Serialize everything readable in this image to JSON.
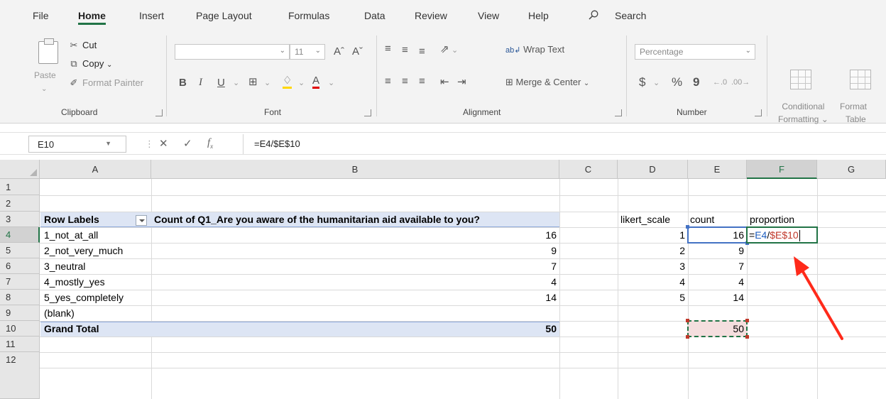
{
  "ribbon_tabs": [
    "File",
    "Home",
    "Insert",
    "Page Layout",
    "Formulas",
    "Data",
    "Review",
    "View",
    "Help"
  ],
  "active_tab": "Home",
  "search_label": "Search",
  "clipboard": {
    "paste": "Paste",
    "cut": "Cut",
    "copy": "Copy",
    "format_painter": "Format Painter",
    "group": "Clipboard"
  },
  "font": {
    "size": "11",
    "bold": "B",
    "italic": "I",
    "underline": "U",
    "group": "Font"
  },
  "alignment": {
    "wrap_text": "Wrap Text",
    "merge_center": "Merge & Center",
    "group": "Alignment"
  },
  "number": {
    "format": "Percentage",
    "currency": "$",
    "percent": "%",
    "comma": "9",
    "group": "Number"
  },
  "styles": {
    "conditional_1": "Conditional",
    "conditional_2": "Formatting",
    "format_table_1": "Format",
    "format_table_2": "Table"
  },
  "formula_bar": {
    "name_box": "E10",
    "formula": "=E4/$E$10"
  },
  "columns": [
    "A",
    "B",
    "C",
    "D",
    "E",
    "F",
    "G"
  ],
  "selected_column": "F",
  "rows": [
    "1",
    "2",
    "3",
    "4",
    "5",
    "6",
    "7",
    "8",
    "9",
    "10",
    "11",
    "12"
  ],
  "selected_row": "4",
  "pivot": {
    "header_labels": "Row Labels",
    "header_values": "Count of Q1_Are you aware of the humanitarian aid available to you?",
    "rows": [
      {
        "label": "1_not_at_all",
        "value": "16"
      },
      {
        "label": "2_not_very_much",
        "value": "9"
      },
      {
        "label": "3_neutral",
        "value": "7"
      },
      {
        "label": "4_mostly_yes",
        "value": "4"
      },
      {
        "label": "5_yes_completely",
        "value": "14"
      },
      {
        "label": "(blank)",
        "value": ""
      }
    ],
    "grand_total_label": "Grand Total",
    "grand_total_value": "50"
  },
  "side_table": {
    "headers": [
      "likert_scale",
      "count",
      "proportion"
    ],
    "rows": [
      {
        "scale": "1",
        "count": "16"
      },
      {
        "scale": "2",
        "count": "9"
      },
      {
        "scale": "3",
        "count": "7"
      },
      {
        "scale": "4",
        "count": "4"
      },
      {
        "scale": "5",
        "count": "14"
      }
    ],
    "total": "50",
    "editing_formula": {
      "prefix": "=",
      "ref1": "E4",
      "op": "/",
      "ref2": "$E$10"
    }
  },
  "colors": {
    "accent": "#217346",
    "pivot_band": "#dde5f4",
    "ref_blue": "#4472c4",
    "ref_red": "#c0392b",
    "arrow": "#ff2a1a"
  }
}
